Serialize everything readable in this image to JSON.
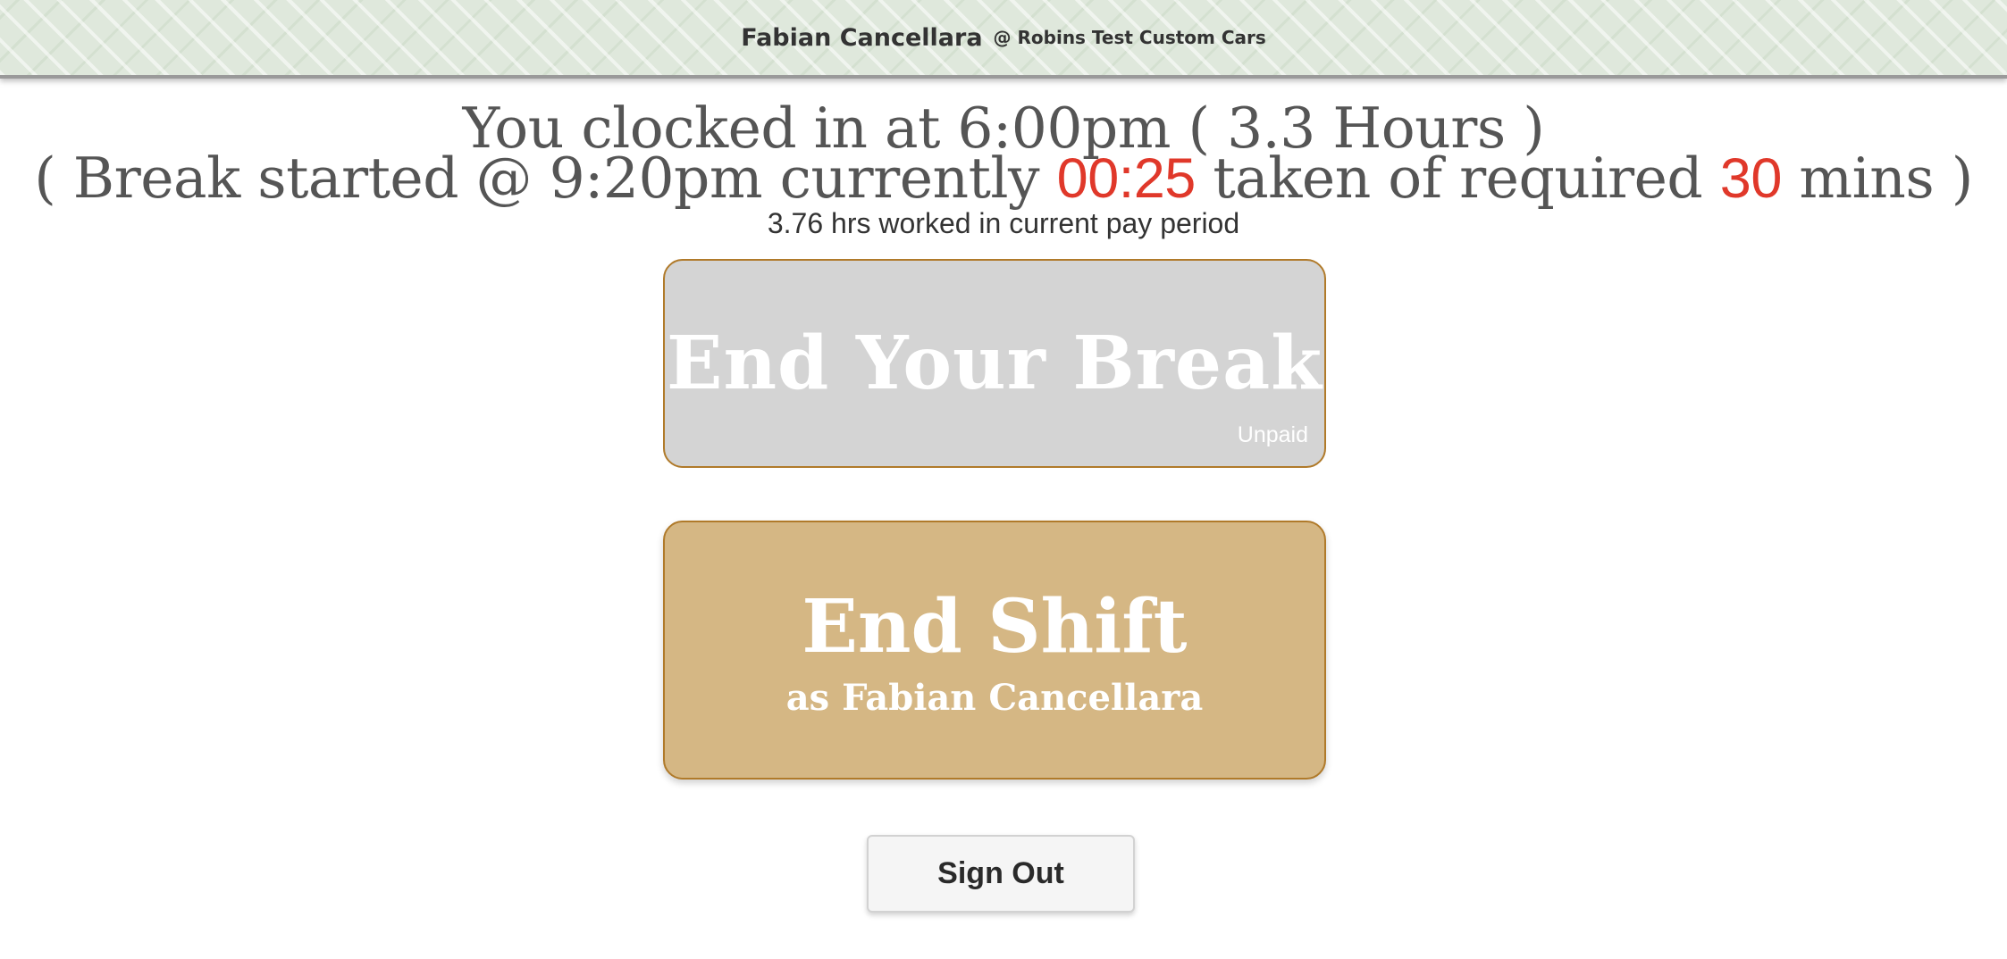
{
  "header": {
    "user_name": "Fabian Cancellara",
    "company": "@ Robins Test Custom Cars"
  },
  "status": {
    "line1": "You clocked in at 6:00pm ( 3.3 Hours )",
    "line2_prefix": "( Break started @ 9:20pm currently ",
    "break_elapsed": "00:25",
    "line2_middle": " taken of required ",
    "break_required": "30",
    "line2_suffix": " mins )",
    "pay_period": "3.76 hrs worked in current pay period"
  },
  "buttons": {
    "end_break_label": "End Your Break",
    "end_break_tag": "Unpaid",
    "end_shift_label": "End Shift",
    "end_shift_sub": "as Fabian Cancellara",
    "sign_out_label": "Sign Out"
  },
  "colors": {
    "header_bg": "#dfe8dc",
    "highlight_red": "#e0382a",
    "break_button_bg": "#d4d4d4",
    "shift_button_bg": "#d5b784",
    "button_border": "#b07a2a"
  }
}
